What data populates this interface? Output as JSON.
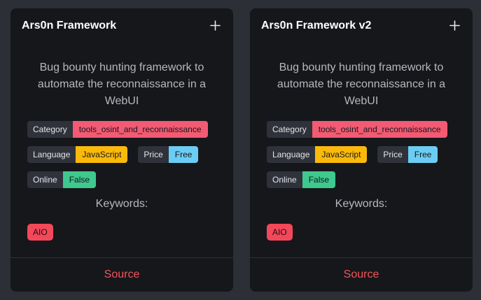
{
  "cards": [
    {
      "title": "Ars0n Framework",
      "add_icon": "plus-icon",
      "description": "Bug bounty hunting framework to automate the reconnaissance in a WebUI",
      "tags": {
        "category": {
          "key": "Category",
          "value": "tools_osint_and_reconnaissance",
          "color": "#f25b73"
        },
        "language": {
          "key": "Language",
          "value": "JavaScript",
          "color": "#fbba0a"
        },
        "price": {
          "key": "Price",
          "value": "Free",
          "color": "#6bcdf3"
        },
        "online": {
          "key": "Online",
          "value": "False",
          "color": "#3ec98f"
        }
      },
      "keywords_label": "Keywords:",
      "keywords": [
        "AIO"
      ],
      "source_label": "Source"
    },
    {
      "title": "Ars0n Framework v2",
      "add_icon": "plus-icon",
      "description": "Bug bounty hunting framework to automate the reconnaissance in a WebUI",
      "tags": {
        "category": {
          "key": "Category",
          "value": "tools_osint_and_reconnaissance",
          "color": "#f25b73"
        },
        "language": {
          "key": "Language",
          "value": "JavaScript",
          "color": "#fbba0a"
        },
        "price": {
          "key": "Price",
          "value": "Free",
          "color": "#6bcdf3"
        },
        "online": {
          "key": "Online",
          "value": "False",
          "color": "#3ec98f"
        }
      },
      "keywords_label": "Keywords:",
      "keywords": [
        "AIO"
      ],
      "source_label": "Source"
    }
  ],
  "colors": {
    "page_bg": "#2c2f36",
    "card_bg": "#16171b",
    "source_link": "#f3545b",
    "keyword_badge": "#f2485a"
  }
}
